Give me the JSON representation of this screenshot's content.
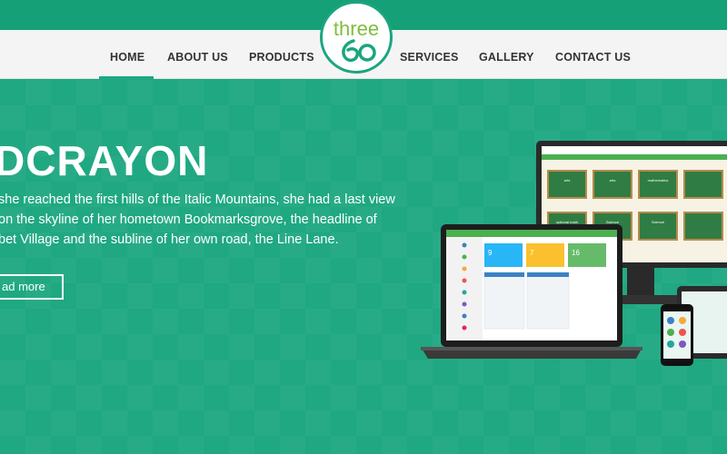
{
  "nav": {
    "items": [
      {
        "label": "HOME",
        "active": true
      },
      {
        "label": "ABOUT US"
      },
      {
        "label": "PRODUCTS"
      },
      {
        "label": "SERVICES"
      },
      {
        "label": "GALLERY"
      },
      {
        "label": "CONTACT US"
      }
    ]
  },
  "logo": {
    "text": "three",
    "mark": "60"
  },
  "hero": {
    "title": "DCRAYON",
    "lines": [
      "she reached the first hills of the Italic Mountains, she had a last view",
      "on the skyline of her hometown Bookmarksgrove, the headline of",
      "bet Village and the subline of her own road, the Line Lane."
    ],
    "button": "ad more"
  },
  "mockup": {
    "desktop_tiles": [
      "arts",
      "arts",
      "mathematics",
      "",
      "optional math",
      "Science",
      "Science",
      ""
    ],
    "laptop_cards": [
      "9",
      "7",
      "16"
    ]
  },
  "colors": {
    "accent": "#1fa882",
    "strip": "#16a077",
    "logo_green": "#7fbe3c"
  }
}
